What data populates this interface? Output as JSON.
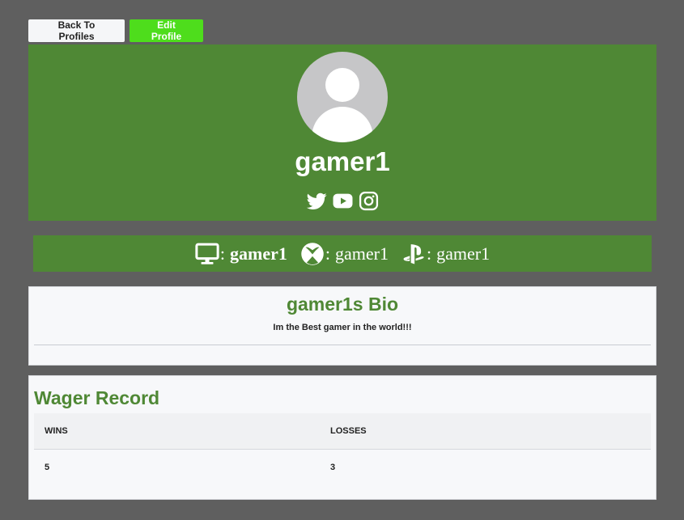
{
  "nav": {
    "back_label": "Back To Profiles",
    "edit_label": "Edit Profile"
  },
  "profile": {
    "username": "gamer1",
    "avatar_icon": "user-avatar-icon",
    "socials": [
      {
        "icon": "twitter-icon"
      },
      {
        "icon": "youtube-icon"
      },
      {
        "icon": "instagram-icon"
      }
    ]
  },
  "platforms": {
    "pc": {
      "icon": "monitor-icon",
      "separator": ":",
      "name": "gamer1"
    },
    "xbox": {
      "icon": "xbox-icon",
      "separator": ":",
      "name": "gamer1"
    },
    "playstation": {
      "icon": "playstation-icon",
      "separator": ":",
      "name": "gamer1"
    }
  },
  "bio": {
    "title": "gamer1s Bio",
    "text": "Im the Best gamer in the world!!!"
  },
  "wager_record": {
    "title": "Wager Record",
    "columns": [
      "WINS",
      "LOSSES"
    ],
    "rows": [
      [
        "5",
        "3"
      ]
    ]
  },
  "colors": {
    "page_background": "#5f5f5f",
    "brand_green": "#4f8835",
    "edit_button": "#4edd1c",
    "card_background": "#f7f8fa"
  }
}
